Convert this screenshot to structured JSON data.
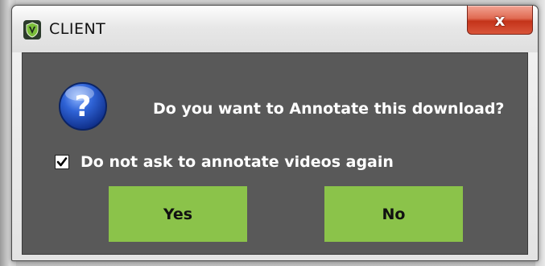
{
  "window": {
    "title": "CLIENT",
    "app_icon": "v-shield-logo",
    "close_label": "x",
    "close_icon": "close-icon"
  },
  "dialog": {
    "icon": "question-icon",
    "message": "Do you want to Annotate this download?",
    "checkbox": {
      "label": "Do not ask to annotate videos again",
      "checked": true
    },
    "buttons": {
      "yes_label": "Yes",
      "no_label": "No"
    }
  },
  "colors": {
    "dialog_background": "#595959",
    "button_green": "#8bc34a",
    "close_red": "#c4331a",
    "question_blue": "#1f4fbf",
    "text_white": "#ffffff"
  }
}
